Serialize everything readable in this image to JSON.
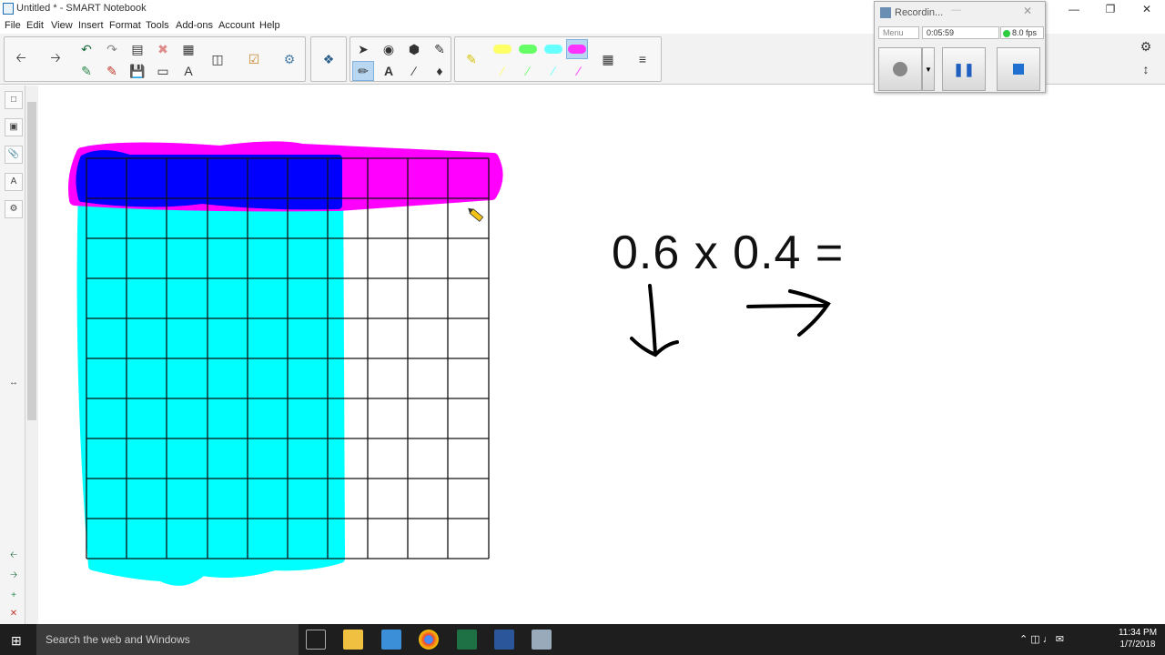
{
  "window": {
    "title": "Untitled * - SMART Notebook"
  },
  "menu": [
    "File",
    "Edit",
    "View",
    "Insert",
    "Format",
    "Tools",
    "Add-ons",
    "Account",
    "Help"
  ],
  "recorder": {
    "title": "Recordin...",
    "menu_label": "Menu",
    "time": "0:05:59",
    "fps": "8.0 fps"
  },
  "equation": {
    "text": "0.6 x 0.4 ="
  },
  "grid": {
    "rows": 10,
    "cols": 10,
    "shaded_cyan_cols": 6,
    "shaded_magenta_rows": 1
  },
  "taskbar": {
    "search_placeholder": "Search the web and Windows",
    "time": "11:34 PM",
    "date": "1/7/2018"
  },
  "colors": {
    "cyan": "#00ffff",
    "magenta": "#ff00ff",
    "overlap": "#0000ff",
    "accent": "#1f6fb5"
  },
  "icons": [
    "back-arrow-icon",
    "forward-arrow-icon",
    "undo-icon",
    "redo-icon",
    "delete-icon",
    "table-icon",
    "screen-shade-icon",
    "check-icon",
    "add-ons-icon",
    "select-pointer-icon",
    "pen-icon",
    "text-icon",
    "line-icon",
    "eraser-icon",
    "highlighter-icon",
    "settings-gear-icon"
  ]
}
